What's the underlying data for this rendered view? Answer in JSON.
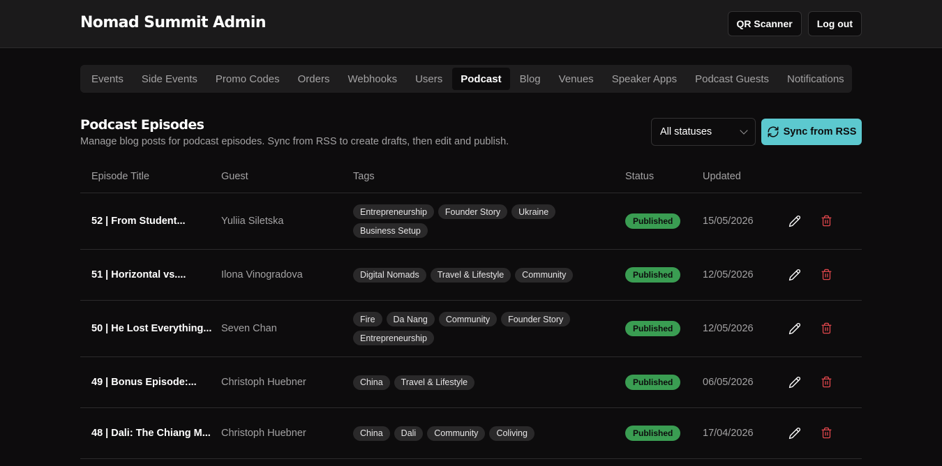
{
  "header": {
    "brand": "Nomad Summit Admin",
    "qr_scanner": "QR Scanner",
    "logout": "Log out"
  },
  "nav": {
    "tabs": [
      {
        "label": "Events",
        "active": false
      },
      {
        "label": "Side Events",
        "active": false
      },
      {
        "label": "Promo Codes",
        "active": false
      },
      {
        "label": "Orders",
        "active": false
      },
      {
        "label": "Webhooks",
        "active": false
      },
      {
        "label": "Users",
        "active": false
      },
      {
        "label": "Podcast",
        "active": true
      },
      {
        "label": "Blog",
        "active": false
      },
      {
        "label": "Venues",
        "active": false
      },
      {
        "label": "Speaker Apps",
        "active": false
      },
      {
        "label": "Podcast Guests",
        "active": false
      },
      {
        "label": "Notifications",
        "active": false
      }
    ]
  },
  "page": {
    "title": "Podcast Episodes",
    "subtitle": "Manage blog posts for podcast episodes. Sync from RSS to create drafts, then edit and publish.",
    "status_filter": "All statuses",
    "sync_label": "Sync from RSS"
  },
  "table": {
    "columns": [
      "Episode Title",
      "Guest",
      "Tags",
      "Status",
      "Updated"
    ],
    "rows": [
      {
        "title": "52 | From Student...",
        "guest": "Yuliia Siletska",
        "tags": [
          "Entrepreneurship",
          "Founder Story",
          "Ukraine",
          "Business Setup"
        ],
        "status": "Published",
        "updated": "15/05/2026"
      },
      {
        "title": "51 | Horizontal vs....",
        "guest": "Ilona Vinogradova",
        "tags": [
          "Digital Nomads",
          "Travel & Lifestyle",
          "Community"
        ],
        "status": "Published",
        "updated": "12/05/2026"
      },
      {
        "title": "50 | He Lost Everything...",
        "guest": "Seven Chan",
        "tags": [
          "Fire",
          "Da Nang",
          "Community",
          "Founder Story",
          "Entrepreneurship"
        ],
        "status": "Published",
        "updated": "12/05/2026"
      },
      {
        "title": "49 | Bonus Episode:...",
        "guest": "Christoph Huebner",
        "tags": [
          "China",
          "Travel & Lifestyle"
        ],
        "status": "Published",
        "updated": "06/05/2026"
      },
      {
        "title": "48 | Dali: The Chiang M...",
        "guest": "Christoph Huebner",
        "tags": [
          "China",
          "Dali",
          "Community",
          "Coliving"
        ],
        "status": "Published",
        "updated": "17/04/2026"
      }
    ]
  },
  "colors": {
    "accent": "#5cc9cf",
    "published": "#3a9d52",
    "delete": "#e5484d"
  }
}
